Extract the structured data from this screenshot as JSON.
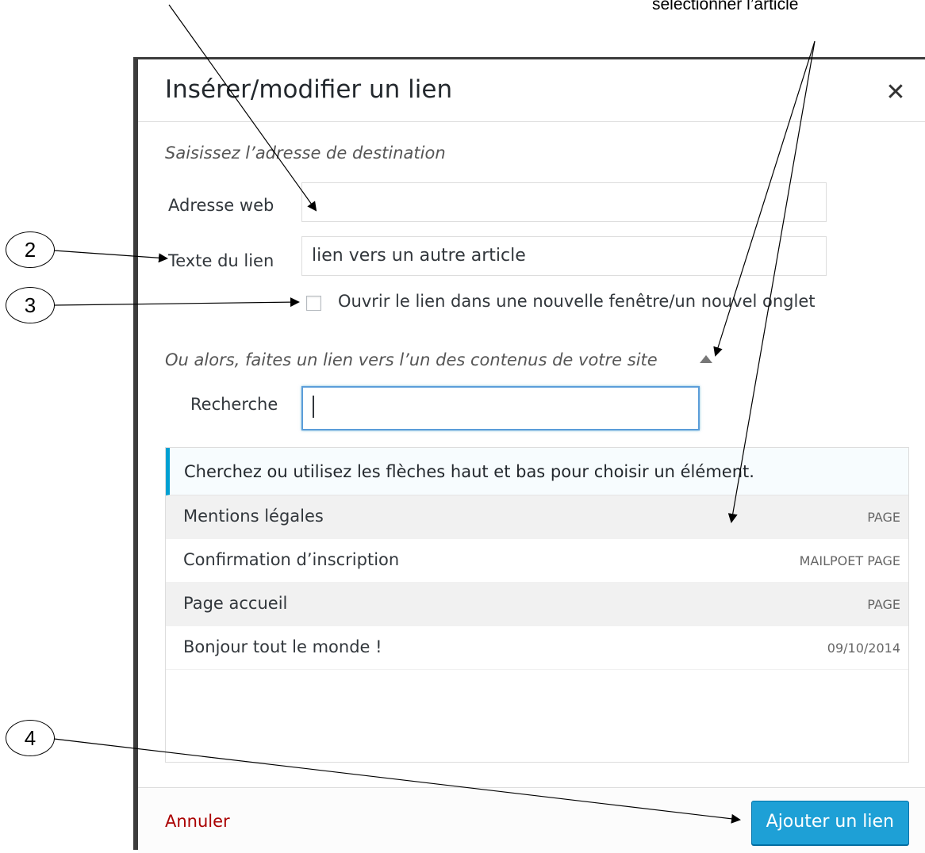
{
  "annotations": {
    "top_label": "sélectionner l’article",
    "callouts": [
      "2",
      "3",
      "4"
    ]
  },
  "dialog": {
    "title": "Insérer/modifier un lien",
    "close_icon": "close-icon",
    "url_section_note": "Saisissez l’adresse de destination",
    "url_label": "Adresse web",
    "url_value": "",
    "link_text_label": "Texte du lien",
    "link_text_value": "lien vers un autre article",
    "new_tab_label": "Ouvrir le lien dans une nouvelle fenêtre/un nouvel onglet",
    "new_tab_checked": false,
    "content_section_note": "Ou alors, faites un lien vers l’un des contenus de votre site",
    "search_label": "Recherche",
    "search_value": "",
    "results_hint": "Cherchez ou utilisez les flèches haut et bas pour choisir un élément.",
    "results": [
      {
        "title": "Mentions légales",
        "meta": "PAGE"
      },
      {
        "title": "Confirmation d’inscription",
        "meta": "MAILPOET PAGE"
      },
      {
        "title": "Page accueil",
        "meta": "PAGE"
      },
      {
        "title": "Bonjour tout le monde !",
        "meta": "09/10/2014"
      }
    ],
    "cancel_label": "Annuler",
    "submit_label": "Ajouter un lien"
  },
  "colors": {
    "accent": "#00a0d2",
    "primary_button": "#1ea0d6",
    "cancel_link": "#aa0000"
  }
}
